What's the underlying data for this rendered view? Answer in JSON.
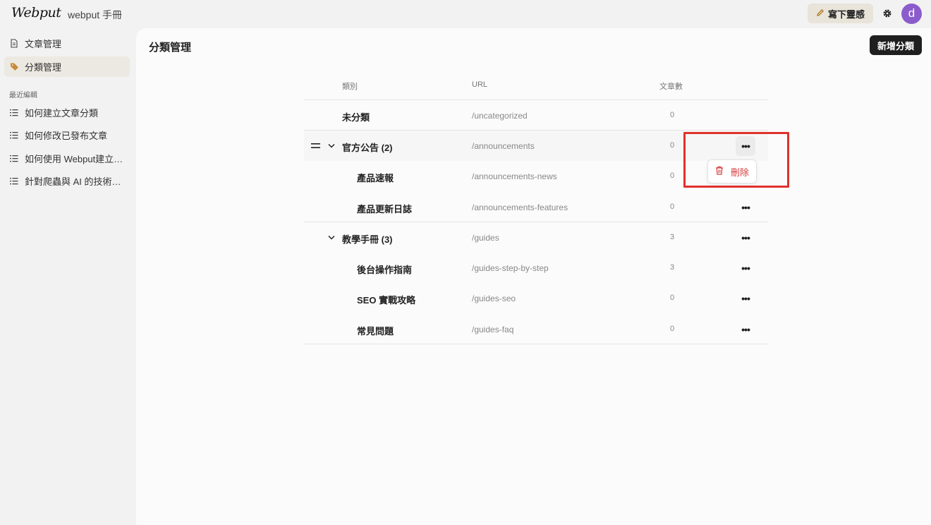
{
  "app": {
    "logo": "Webput",
    "site_name": "webput 手冊"
  },
  "header": {
    "write_label": "寫下靈感",
    "avatar_letter": "d"
  },
  "sidebar": {
    "nav": [
      {
        "label": "文章管理",
        "icon": "document-icon"
      },
      {
        "label": "分類管理",
        "icon": "tag-icon",
        "active": true
      }
    ],
    "recent_label": "最近編輯",
    "recent": [
      {
        "label": "如何建立文章分類"
      },
      {
        "label": "如何修改已發布文章"
      },
      {
        "label": "如何使用 Webput建立…"
      },
      {
        "label": "針對爬蟲與 AI 的技術優…"
      }
    ]
  },
  "main": {
    "title": "分類管理",
    "add_button": "新增分類",
    "columns": {
      "category": "類別",
      "url": "URL",
      "count": "文章數"
    },
    "rows": [
      {
        "name": "未分類",
        "url": "/uncategorized",
        "count": "0"
      },
      {
        "name": "官方公告 (2)",
        "url": "/announcements",
        "count": "0"
      },
      {
        "name": "產品速報",
        "url": "/announcements-news",
        "count": "0"
      },
      {
        "name": "產品更新日誌",
        "url": "/announcements-features",
        "count": "0"
      },
      {
        "name": "教學手冊 (3)",
        "url": "/guides",
        "count": "3"
      },
      {
        "name": "後台操作指南",
        "url": "/guides-step-by-step",
        "count": "3"
      },
      {
        "name": "SEO 實戰攻略",
        "url": "/guides-seo",
        "count": "0"
      },
      {
        "name": "常見問題",
        "url": "/guides-faq",
        "count": "0"
      }
    ],
    "more_glyph": "•••",
    "context_menu": {
      "delete_label": "刪除"
    }
  },
  "colors": {
    "accent": "#8b5ccc",
    "danger": "#d63b3b",
    "highlight": "#e0312b",
    "tag": "#c98a3a"
  }
}
